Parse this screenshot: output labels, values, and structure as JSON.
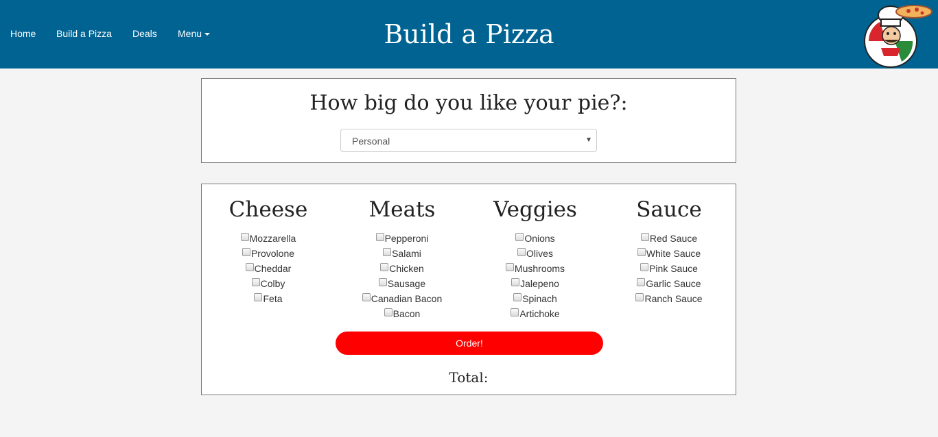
{
  "nav": {
    "home": "Home",
    "build": "Build a Pizza",
    "deals": "Deals",
    "menu": "Menu"
  },
  "header": {
    "title": "Build a Pizza"
  },
  "size": {
    "heading": "How big do you like your pie?:",
    "selected": "Personal"
  },
  "toppings": {
    "cheese": {
      "title": "Cheese",
      "items": [
        "Mozzarella",
        "Provolone",
        "Cheddar",
        "Colby",
        "Feta"
      ]
    },
    "meats": {
      "title": "Meats",
      "items": [
        "Pepperoni",
        "Salami",
        "Chicken",
        "Sausage",
        "Canadian Bacon",
        "Bacon"
      ]
    },
    "veggies": {
      "title": "Veggies",
      "items": [
        "Onions",
        "Olives",
        "Mushrooms",
        "Jalepeno",
        "Spinach",
        "Artichoke"
      ]
    },
    "sauce": {
      "title": "Sauce",
      "items": [
        "Red Sauce",
        "White Sauce",
        "Pink Sauce",
        "Garlic Sauce",
        "Ranch Sauce"
      ]
    }
  },
  "order": {
    "button": "Order!",
    "total_label": "Total:"
  },
  "colors": {
    "navbar": "#006392",
    "order_button": "#ff0000",
    "background": "#f4f4f4"
  },
  "icons": {
    "logo": "pizza-chef-logo-icon",
    "menu_caret": "caret-down-icon"
  }
}
